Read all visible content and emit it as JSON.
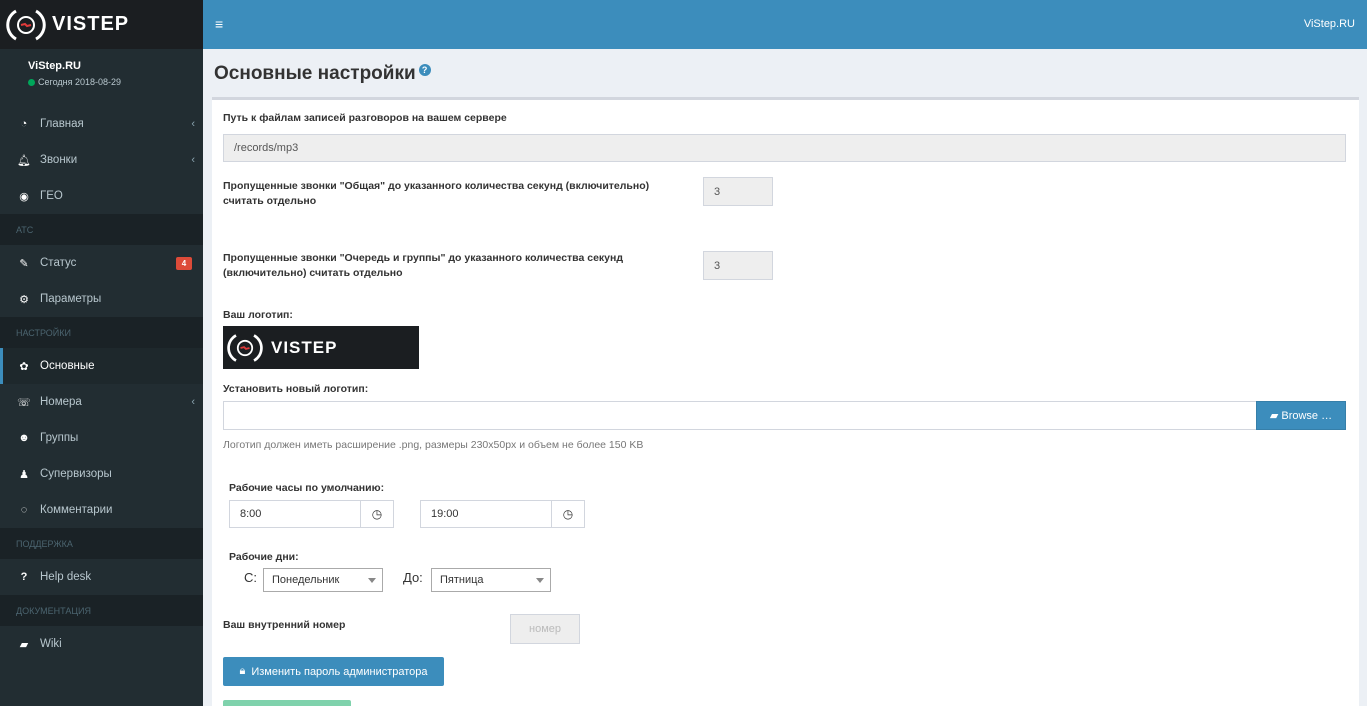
{
  "brand": {
    "logo_text": "VISTEP"
  },
  "user": {
    "name": "ViStep.RU",
    "status": "Сегодня 2018-08-29"
  },
  "sidebar": {
    "items": [
      {
        "label": "Главная",
        "icon": "dashboard-icon"
      },
      {
        "label": "Звонки",
        "icon": "bell-icon"
      },
      {
        "label": "ГЕО",
        "icon": "globe-icon"
      },
      {
        "header": "АТС"
      },
      {
        "label": "Статус",
        "icon": "wrench-icon",
        "badge": "4"
      },
      {
        "label": "Параметры",
        "icon": "cogs-icon"
      },
      {
        "header": "НАСТРОЙКИ"
      },
      {
        "label": "Основные",
        "icon": "cog-icon"
      },
      {
        "label": "Номера",
        "icon": "phone-icon"
      },
      {
        "label": "Группы",
        "icon": "users-icon"
      },
      {
        "label": "Супервизоры",
        "icon": "person-icon"
      },
      {
        "label": "Комментарии",
        "icon": "comment-icon"
      },
      {
        "header": "ПОДДЕРЖКА"
      },
      {
        "label": "Help desk",
        "icon": "question-icon"
      },
      {
        "header": "ДОКУМЕНТАЦИЯ"
      },
      {
        "label": "Wiki",
        "icon": "book-icon"
      }
    ]
  },
  "header": {
    "site_link": "ViStep.RU"
  },
  "page": {
    "title": "Основные настройки"
  },
  "form": {
    "path_label": "Путь к файлам записей разговоров на вашем сервере",
    "path_value": "/records/mp3",
    "missed_general_label_1": "Пропущенные звонки \"Общая\" до указанного количества секунд (включительно)",
    "missed_general_label_2": "считать отдельно",
    "missed_general_value": "3",
    "missed_queue_label_1": "Пропущенные звонки \"Очередь и группы\" до указанного количества секунд",
    "missed_queue_label_2": "(включительно) считать отдельно",
    "missed_queue_value": "3",
    "logo_label": "Ваш логотип:",
    "new_logo_label": "Установить новый логотип:",
    "browse_label": "Browse …",
    "logo_hint": "Логотип должен иметь расширение .png, размеры 230x50px и объем не более 150 KB",
    "work_hours_label": "Рабочие часы по умолчанию:",
    "work_start": "8:00",
    "work_end": "19:00",
    "work_days_label": "Рабочие дни:",
    "from_label": "С:",
    "to_label": "До:",
    "from_day": "Понедельник",
    "to_day": "Пятница",
    "ext_label": "Ваш внутренний номер",
    "ext_placeholder": "номер",
    "change_pwd_label": "Изменить пароль администратора"
  },
  "colors": {
    "primary": "#3c8dbc",
    "sidebar": "#222d32",
    "success": "#00a65a",
    "danger": "#dd4b39"
  }
}
